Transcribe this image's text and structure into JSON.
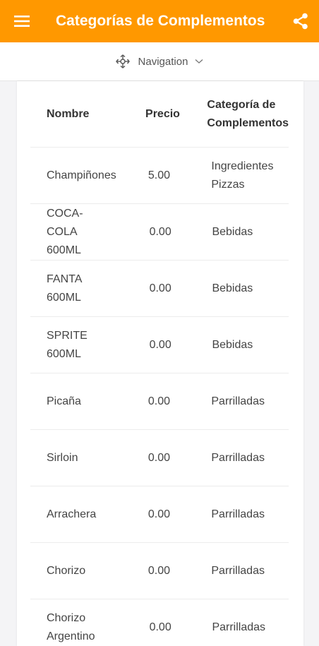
{
  "appbar": {
    "title": "Categorías de Complementos",
    "background": "#ff9800",
    "menu_icon": "hamburger-menu-icon",
    "share_icon": "share-icon"
  },
  "navigation": {
    "label": "Navigation",
    "icon": "navigation-compass-icon",
    "chevron": "chevron-down-icon"
  },
  "table": {
    "columns": [
      "Nombre",
      "Precio",
      "Categoría de",
      "Complementos"
    ],
    "rows": [
      {
        "name": "Champiñones",
        "price": "5.00",
        "category": "Ingredientes Pizzas"
      },
      {
        "name": "COCA-COLA 600ML",
        "price": "0.00",
        "category": "Bebidas"
      },
      {
        "name": "FANTA 600ML",
        "price": "0.00",
        "category": "Bebidas"
      },
      {
        "name": "SPRITE 600ML",
        "price": "0.00",
        "category": "Bebidas"
      },
      {
        "name": "Picaña",
        "price": "0.00",
        "category": "Parrilladas"
      },
      {
        "name": "Sirloin",
        "price": "0.00",
        "category": "Parrilladas"
      },
      {
        "name": "Arrachera",
        "price": "0.00",
        "category": "Parrilladas"
      },
      {
        "name": "Chorizo",
        "price": "0.00",
        "category": "Parrilladas"
      },
      {
        "name": "Chorizo Argentino",
        "price": "0.00",
        "category": "Parrilladas"
      }
    ]
  }
}
